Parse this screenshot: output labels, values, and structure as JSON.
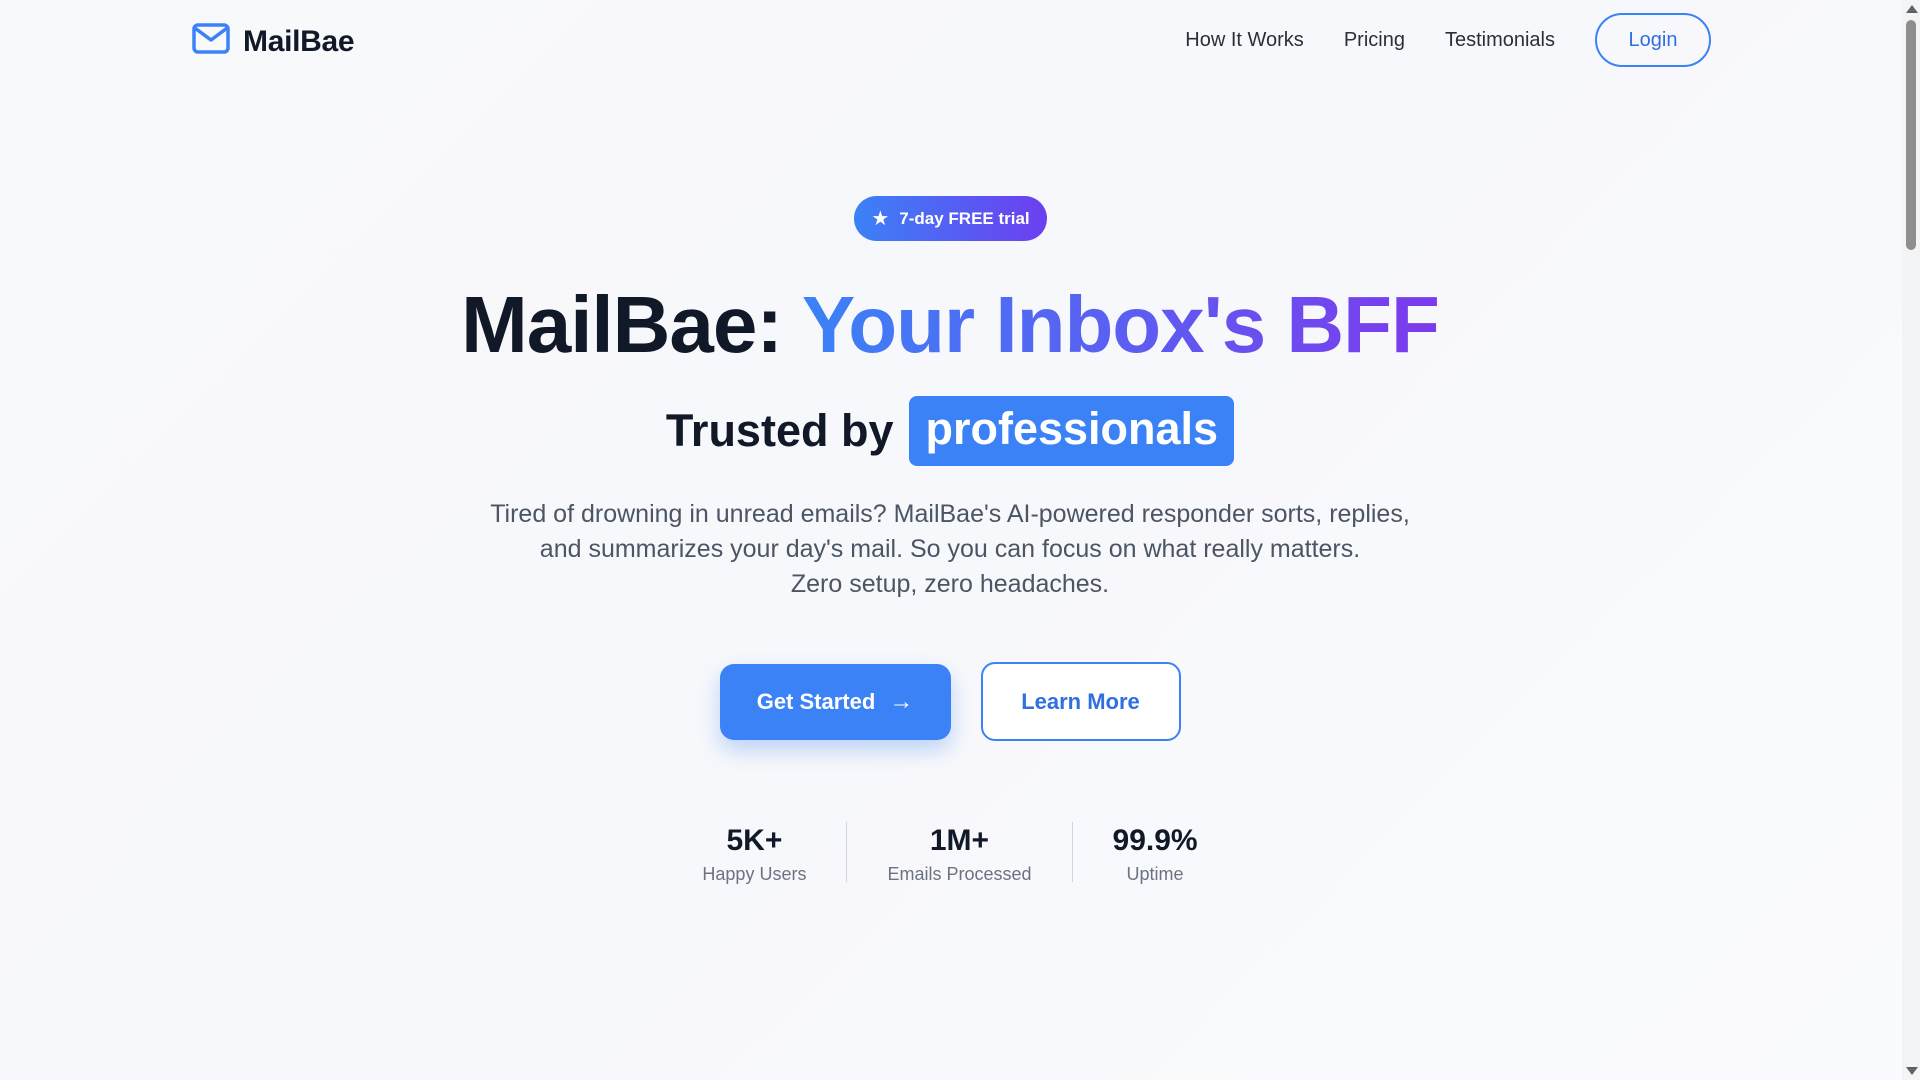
{
  "nav": {
    "brand": "MailBae",
    "links": [
      "How It Works",
      "Pricing",
      "Testimonials"
    ],
    "login": "Login"
  },
  "hero": {
    "badge": "7-day FREE trial",
    "headline_part1": "MailBae:",
    "headline_part2": "Your Inbox's BFF",
    "trusted_lead": "Trusted by",
    "trusted_highlight": "professionals",
    "description_lines": [
      "Tired of drowning in unread emails? MailBae's AI-powered responder sorts, replies,",
      "and summarizes your day's mail. So you can focus on what really matters.",
      "Zero setup, zero headaches."
    ],
    "primary_cta": "Get Started",
    "secondary_cta": "Learn More"
  },
  "stats": [
    {
      "value": "5K+",
      "label": "Happy Users"
    },
    {
      "value": "1M+",
      "label": "Emails Processed"
    },
    {
      "value": "99.9%",
      "label": "Uptime"
    }
  ],
  "icons": {
    "brand": "mail-icon",
    "badge": "star-icon",
    "cta": "arrow-right-icon"
  },
  "colors": {
    "accent": "#3b82f6",
    "accent_purple": "#7c3aed",
    "text": "#111827"
  }
}
